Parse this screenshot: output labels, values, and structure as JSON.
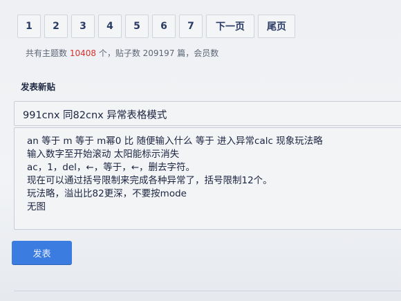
{
  "pagination": {
    "pages": [
      "1",
      "2",
      "3",
      "4",
      "5",
      "6",
      "7"
    ],
    "next_label": "下一页",
    "last_label": "尾页"
  },
  "stats": {
    "prefix": "共有主题数 ",
    "topic_count": "10408",
    "middle": " 个，贴子数 209197 篇，会员数"
  },
  "new_post": {
    "section_title": "发表新贴",
    "title_value": "991cnx 同82cnx 异常表格模式",
    "content_lines": [
      "an 等于 m 等于 m幂0 比 随便输入什么 等于 进入异常calc 现象玩法略",
      "输入数字至开始滚动 太阳能标示消失",
      "ac，1，del，←，等于，←，删去字符。",
      "现在可以通过括号限制来完成各种异常了，括号限制12个。",
      "玩法略，溢出比82更深，不要按mode",
      "无图"
    ],
    "submit_label": "发表"
  },
  "colors": {
    "accent": "#3b7ce0",
    "highlight": "#d2332f"
  }
}
